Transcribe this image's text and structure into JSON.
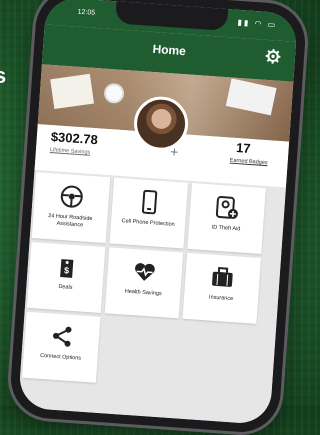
{
  "statusbar": {
    "time": "12:05"
  },
  "header": {
    "title": "Home"
  },
  "stats": {
    "savings_value": "$302.78",
    "savings_label": "Lifetime Savings",
    "badges_value": "17",
    "badges_label": "Earned Badges"
  },
  "tiles": [
    {
      "label": "24 Hour Roadside Assistance",
      "icon": "steering-wheel-icon"
    },
    {
      "label": "Cell Phone Protection",
      "icon": "phone-icon"
    },
    {
      "label": "ID Theft Aid",
      "icon": "id-person-icon"
    },
    {
      "label": "Deals",
      "icon": "price-tag-icon"
    },
    {
      "label": "Health Savings",
      "icon": "heartbeat-icon"
    },
    {
      "label": "Insurance",
      "icon": "briefcase-icon"
    },
    {
      "label": "Connect Options",
      "icon": "share-icon"
    }
  ],
  "colors": {
    "header": "#1f5c2f",
    "background": "#1f5e2d"
  }
}
